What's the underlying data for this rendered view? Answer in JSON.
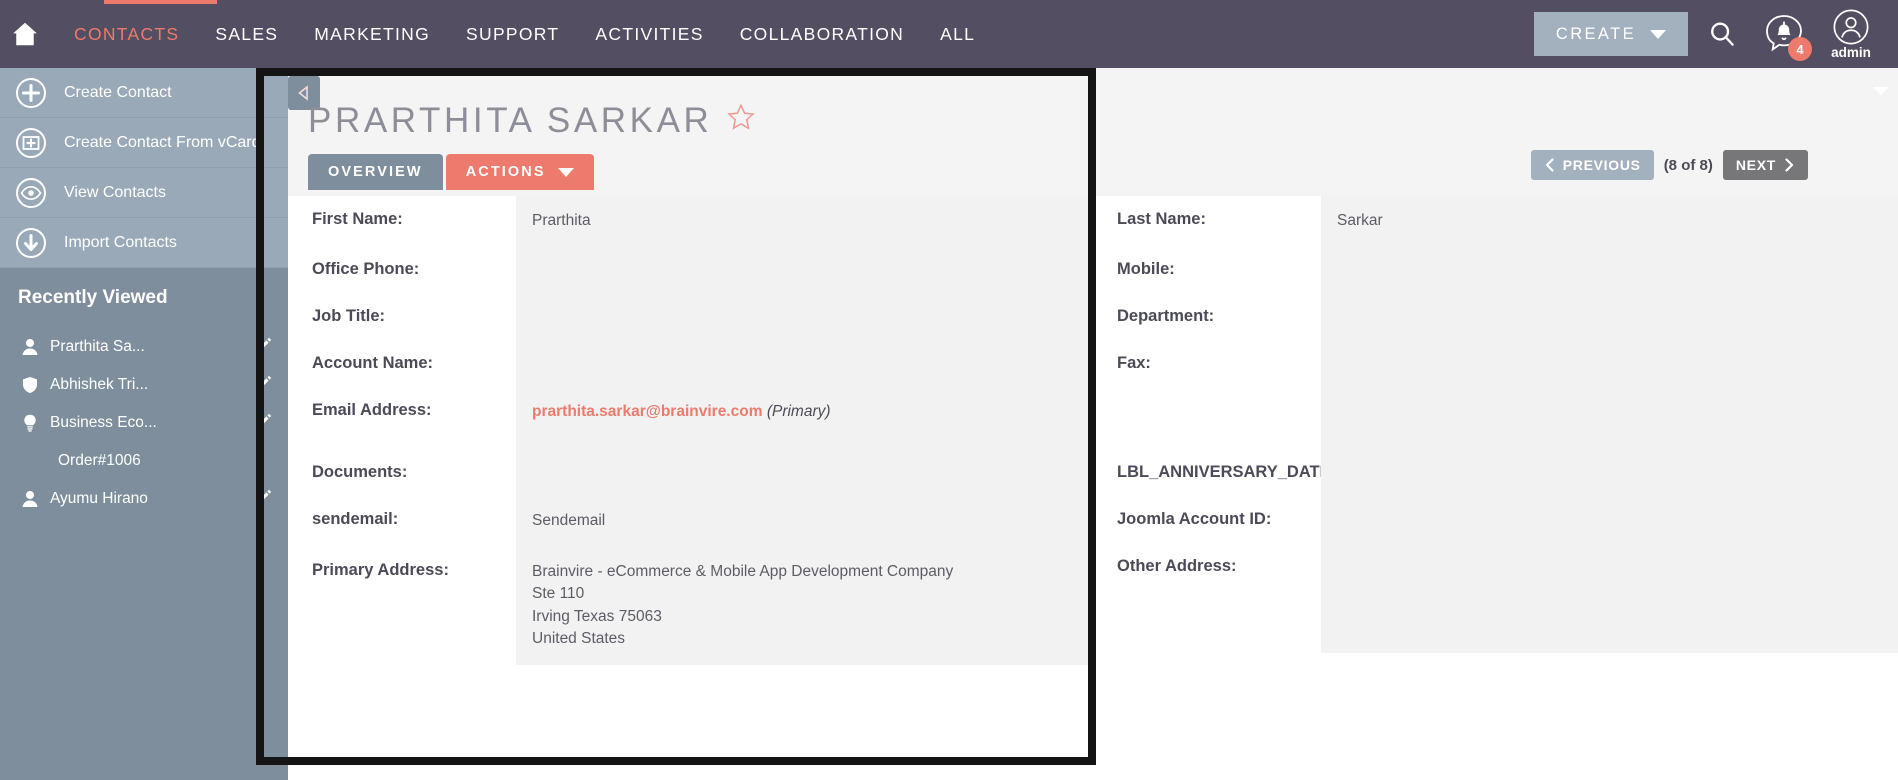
{
  "topnav": {
    "home_icon": "home-icon",
    "items": [
      {
        "label": "CONTACTS",
        "active": true
      },
      {
        "label": "SALES",
        "active": false
      },
      {
        "label": "MARKETING",
        "active": false
      },
      {
        "label": "SUPPORT",
        "active": false
      },
      {
        "label": "ACTIVITIES",
        "active": false
      },
      {
        "label": "COLLABORATION",
        "active": false
      },
      {
        "label": "ALL",
        "active": false
      }
    ],
    "create_label": "CREATE",
    "search_icon": "search-icon",
    "notification_icon": "notification-bell-icon",
    "notification_count": "4",
    "user_icon": "user-avatar-icon",
    "user_name": "admin",
    "accent_color": "#ec7b6d",
    "bar_color": "#534e61"
  },
  "sidebar": {
    "actions": [
      {
        "label": "Create Contact",
        "icon": "plus-circle-icon"
      },
      {
        "label": "Create Contact From vCard",
        "icon": "import-card-icon"
      },
      {
        "label": "View Contacts",
        "icon": "eye-icon"
      },
      {
        "label": "Import Contacts",
        "icon": "download-arrow-icon"
      }
    ],
    "recently_viewed_title": "Recently Viewed",
    "recent_items": [
      {
        "label": "Prarthita Sa...",
        "icon": "person-icon",
        "edit": true
      },
      {
        "label": "Abhishek Tri...",
        "icon": "shield-icon",
        "edit": true
      },
      {
        "label": "Business Eco...",
        "icon": "lightbulb-icon",
        "edit": true
      },
      {
        "label": "Order#1006",
        "icon": "",
        "edit": false
      },
      {
        "label": "Ayumu Hirano",
        "icon": "person-icon",
        "edit": true
      }
    ]
  },
  "record": {
    "collapse_icon": "collapse-left-icon",
    "title": "PRARTHITA SARKAR",
    "favorite_icon": "star-outline-icon",
    "tabs": [
      {
        "label": "OVERVIEW",
        "style": "overview"
      },
      {
        "label": "ACTIONS",
        "style": "actions",
        "caret": true
      }
    ],
    "pager": {
      "previous_label": "PREVIOUS",
      "count_label": "(8 of 8)",
      "next_label": "NEXT"
    }
  },
  "fields": {
    "left": [
      {
        "label": "First Name:",
        "value": "Prarthita",
        "type": "text"
      },
      {
        "label": "Office Phone:",
        "value": "",
        "type": "text"
      },
      {
        "label": "Job Title:",
        "value": "",
        "type": "text"
      },
      {
        "label": "Account Name:",
        "value": "",
        "type": "text"
      },
      {
        "label": "Email Address:",
        "value": "prarthita.sarkar@brainvire.com",
        "suffix": "(Primary)",
        "type": "email"
      },
      {
        "label": "Documents:",
        "value": "",
        "type": "text"
      },
      {
        "label": "sendemail:",
        "value": "Sendemail",
        "type": "text"
      },
      {
        "label": "Primary Address:",
        "value": "Brainvire - eCommerce & Mobile App Development Company\nSte 110\nIrving Texas  75063\nUnited States",
        "type": "multiline"
      }
    ],
    "right": [
      {
        "label": "Last Name:",
        "value": "Sarkar",
        "type": "text"
      },
      {
        "label": "Mobile:",
        "value": "",
        "type": "text"
      },
      {
        "label": "Department:",
        "value": "",
        "type": "text"
      },
      {
        "label": "Fax:",
        "value": "",
        "type": "text"
      },
      {
        "label": "",
        "value": "",
        "type": "blank"
      },
      {
        "label": "LBL_ANNIVERSARY_DATE:",
        "value": "",
        "type": "text"
      },
      {
        "label": "Joomla Account ID:",
        "value": "",
        "type": "text"
      },
      {
        "label": "Other Address:",
        "value": "",
        "type": "multiline"
      }
    ]
  }
}
